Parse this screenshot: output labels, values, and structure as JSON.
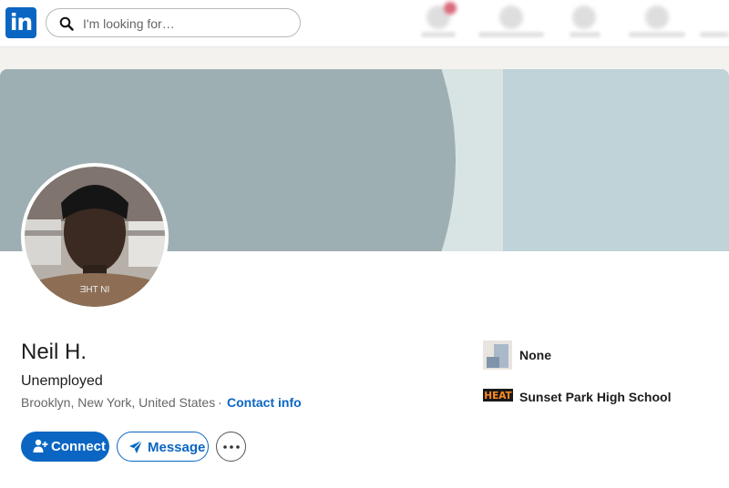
{
  "header": {
    "logo_text": "in",
    "search_placeholder": "I'm looking for…"
  },
  "profile": {
    "name": "Neil H.",
    "headline": "Unemployed",
    "location": "Brooklyn, New York, United States",
    "separator": "·",
    "contact_info": "Contact info"
  },
  "actions": {
    "connect": "Connect",
    "message": "Message"
  },
  "sidebar": {
    "company": "None",
    "school": "Sunset Park High School",
    "school_logo_text": "HEAT"
  },
  "colors": {
    "brand": "#0a66c2",
    "banner_light": "#bfd3d8",
    "banner_dark": "#9eafb3"
  },
  "icons": {
    "search": "search-icon",
    "connect": "add-person-icon",
    "message": "paper-plane-icon",
    "more": "ellipsis-icon"
  }
}
